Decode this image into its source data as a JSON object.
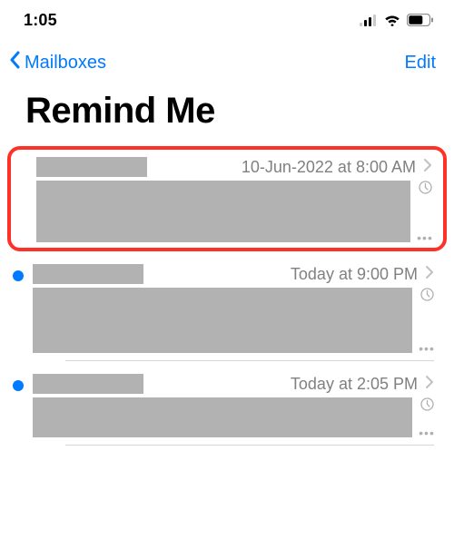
{
  "status": {
    "time": "1:05"
  },
  "nav": {
    "back_label": "Mailboxes",
    "edit_label": "Edit"
  },
  "title": "Remind Me",
  "mails": [
    {
      "timestamp": "10-Jun-2022 at 8:00 AM",
      "unread": false
    },
    {
      "timestamp": "Today at 9:00 PM",
      "unread": true
    },
    {
      "timestamp": "Today at 2:05 PM",
      "unread": true
    }
  ]
}
